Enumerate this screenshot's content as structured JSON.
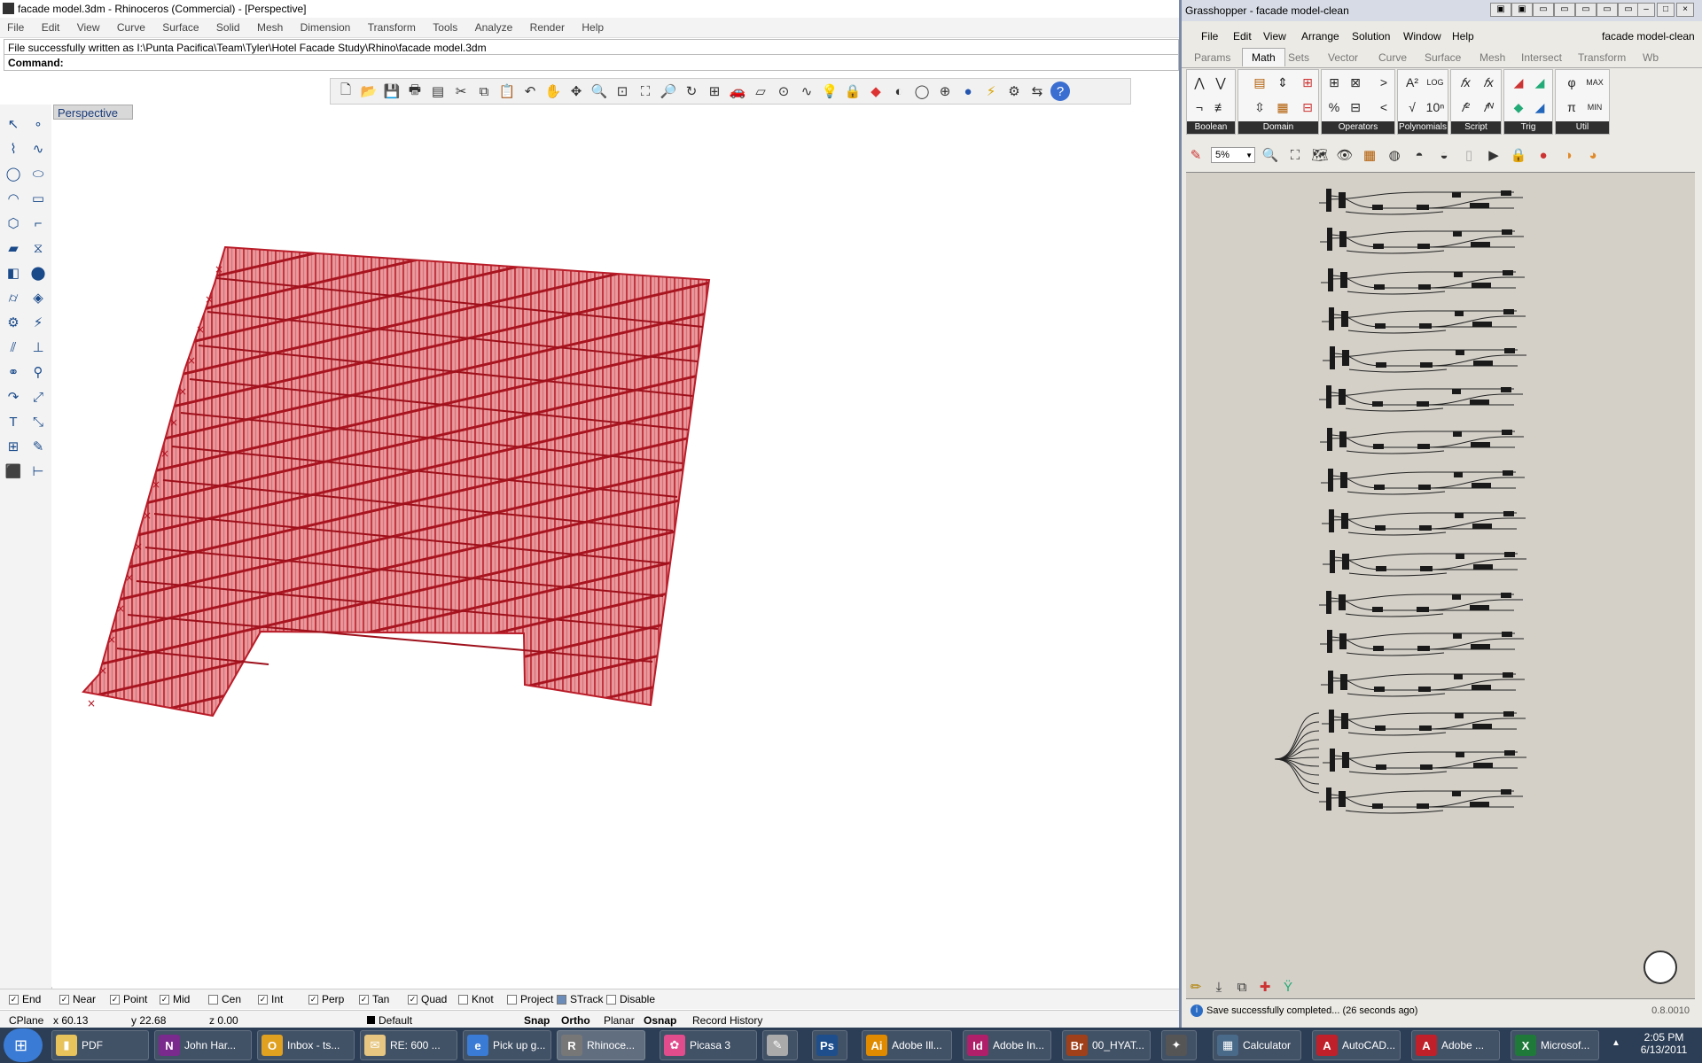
{
  "rhino": {
    "title": "facade model.3dm - Rhinoceros (Commercial) - [Perspective]",
    "menu": [
      "File",
      "Edit",
      "View",
      "Curve",
      "Surface",
      "Solid",
      "Mesh",
      "Dimension",
      "Transform",
      "Tools",
      "Analyze",
      "Render",
      "Help"
    ],
    "history": "File successfully written as I:\\Punta Pacifica\\Team\\Tyler\\Hotel Facade Study\\Rhino\\facade model.3dm",
    "command_label": "Command:",
    "viewport_label": "Perspective",
    "osnaps": [
      {
        "label": "End",
        "checked": true
      },
      {
        "label": "Near",
        "checked": true
      },
      {
        "label": "Point",
        "checked": true
      },
      {
        "label": "Mid",
        "checked": true
      },
      {
        "label": "Cen",
        "checked": false
      },
      {
        "label": "Int",
        "checked": true
      },
      {
        "label": "Perp",
        "checked": true
      },
      {
        "label": "Tan",
        "checked": true
      },
      {
        "label": "Quad",
        "checked": true
      },
      {
        "label": "Knot",
        "checked": false
      },
      {
        "label": "Project",
        "checked": false
      },
      {
        "label": "STrack",
        "checked": true
      },
      {
        "label": "Disable",
        "checked": false
      }
    ],
    "status": {
      "cplane": "CPlane",
      "x": "x 60.13",
      "y": "y 22.68",
      "z": "z 0.00",
      "layer": "Default",
      "snap": "Snap",
      "ortho": "Ortho",
      "planar": "Planar",
      "osnap": "Osnap",
      "record": "Record History"
    }
  },
  "grasshopper": {
    "title": "Grasshopper - facade model-clean",
    "doc_name": "facade model-clean",
    "menu": [
      "File",
      "Edit",
      "View",
      "Arrange",
      "Solution",
      "Window",
      "Help"
    ],
    "tabs": [
      "Params",
      "Math",
      "Sets",
      "Vector",
      "Curve",
      "Surface",
      "Mesh",
      "Intersect",
      "Transform",
      "Wb"
    ],
    "active_tab": "Math",
    "groups": [
      "Boolean",
      "Domain",
      "Operators",
      "Polynomials",
      "Script",
      "Trig",
      "Util"
    ],
    "zoom": "5%",
    "status": "Save successfully completed... (26 seconds ago)",
    "version": "0.8.0010"
  },
  "taskbar": {
    "items": [
      "PDF",
      "John Har...",
      "Inbox - ts...",
      "RE: 600 ...",
      "Pick up g...",
      "Rhinoce...",
      "Picasa 3",
      "",
      "",
      "Adobe Ill...",
      "Adobe In...",
      "00_HYAT...",
      "",
      "Calculator",
      "AutoCAD...",
      "Adobe ...",
      "Microsof..."
    ],
    "time": "2:05 PM",
    "date": "6/13/2011"
  }
}
